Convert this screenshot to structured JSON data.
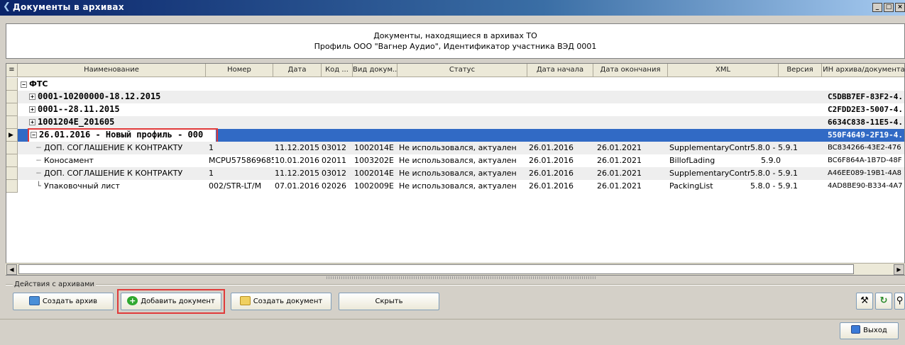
{
  "window": {
    "title": "Документы в архивах",
    "controls": [
      "_",
      "□",
      "×"
    ]
  },
  "header": {
    "line1": "Документы, находящиеся в архивах ТО",
    "line2": "Профиль ООО \"Вагнер Аудио\", Идентификатор участника ВЭД 0001"
  },
  "table": {
    "columns": [
      "Наименование",
      "Номер",
      "Дата",
      "Код ...",
      "Вид докум...",
      "Статус",
      "Дата начала",
      "Дата окончания",
      "XML",
      "Версия",
      "ИН архива/документа"
    ],
    "root": "ФТС",
    "groups": [
      {
        "name": "0001-10200000-18.12.2015",
        "archive_id": "C5DBB7EF-83F2-4..."
      },
      {
        "name": "0001--28.11.2015",
        "archive_id": "C2FDD2E3-5007-4..."
      },
      {
        "name": "1001204E_201605",
        "archive_id": "6634C838-11E5-4..."
      },
      {
        "name": "26.01.2016 - Новый профиль - 000",
        "archive_id": "550F4649-2F19-4..."
      }
    ],
    "rows": [
      {
        "name": "ДОП. СОГЛАШЕНИЕ К КОНТРАКТУ",
        "number": "1",
        "date": "11.12.2015",
        "code": "03012",
        "kind": "1002014E",
        "status": "Не использовался, актуален",
        "start": "26.01.2016",
        "end": "26.01.2021",
        "xml": "SupplementaryContra",
        "version": "5.8.0 - 5.9.1",
        "archive_id": "BC834266-43E2-476"
      },
      {
        "name": "Коносамент",
        "number": "MCPU575869685",
        "date": "10.01.2016",
        "code": "02011",
        "kind": "1003202E",
        "status": "Не использовался, актуален",
        "start": "26.01.2016",
        "end": "26.01.2021",
        "xml": "BillofLading",
        "version": "5.9.0",
        "archive_id": "BC6F864A-1B7D-48F"
      },
      {
        "name": "ДОП. СОГЛАШЕНИЕ К КОНТРАКТУ",
        "number": "1",
        "date": "11.12.2015",
        "code": "03012",
        "kind": "1002014E",
        "status": "Не использовался, актуален",
        "start": "26.01.2016",
        "end": "26.01.2021",
        "xml": "SupplementaryContra",
        "version": "5.8.0 - 5.9.1",
        "archive_id": "A46EE089-19B1-4A8"
      },
      {
        "name": "Упаковочный лист",
        "number": "002/STR-LT/M",
        "date": "07.01.2016",
        "code": "02026",
        "kind": "1002009E",
        "status": "Не использовался, актуален",
        "start": "26.01.2016",
        "end": "26.01.2021",
        "xml": "PackingList",
        "version": "5.8.0 - 5.9.1",
        "archive_id": "4AD8BE90-B334-4A7"
      }
    ]
  },
  "actions": {
    "label": "Действия с архивами",
    "create_archive": "Создать архив",
    "add_document": "Добавить документ",
    "create_document": "Создать документ",
    "hide": "Скрыть"
  },
  "footer": {
    "exit": "Выход"
  },
  "colors": {
    "selection": "#316ac5",
    "highlight": "#e03a3a"
  }
}
